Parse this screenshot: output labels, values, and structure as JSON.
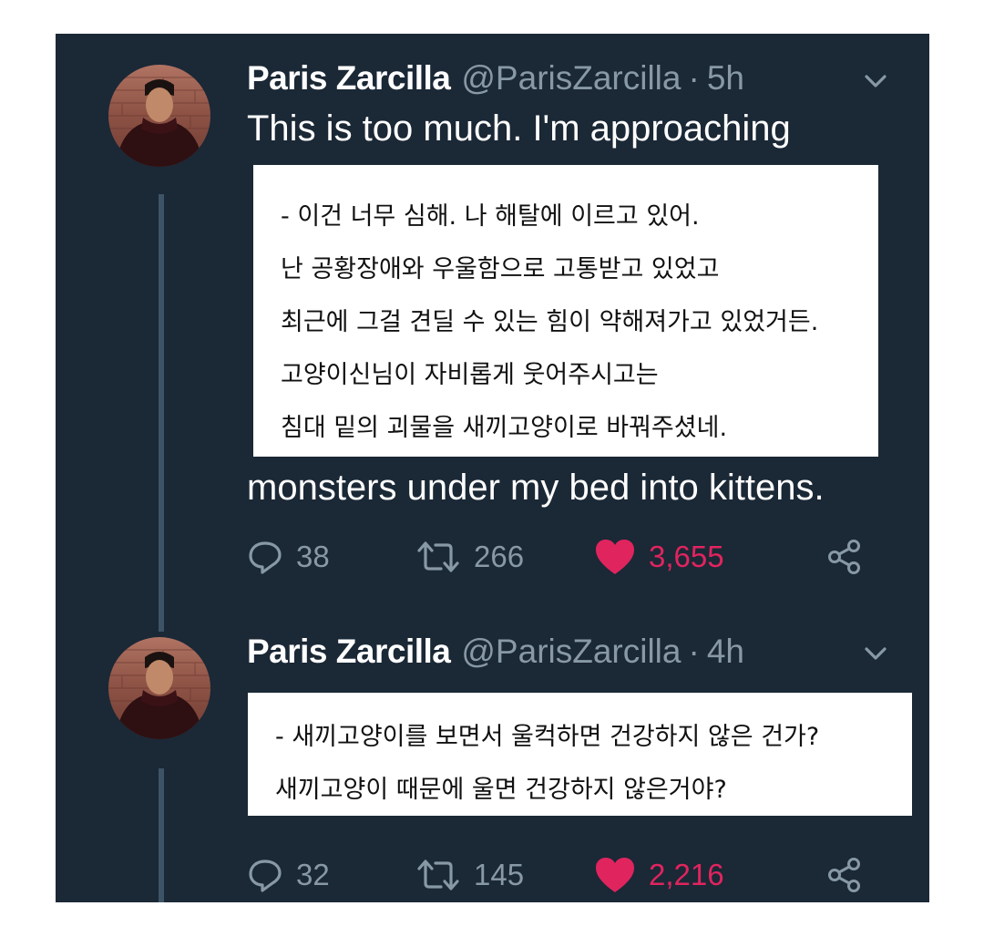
{
  "tweets": [
    {
      "name": "Paris Zarcilla",
      "handle": "@ParisZarcilla",
      "dot": "·",
      "time": "5h",
      "text_first_line": "This is too much. I'm approaching",
      "text_last_line": "monsters under my bed into kittens.",
      "replies": "38",
      "retweets": "266",
      "likes": "3,655",
      "overlay_lines": [
        "- 이건 너무 심해. 나 해탈에 이르고 있어.",
        "난 공황장애와 우울함으로 고통받고 있었고",
        "최근에 그걸 견딜 수 있는 힘이 약해져가고 있었거든.",
        "고양이신님이 자비롭게 웃어주시고는",
        "침대 밑의 괴물을 새끼고양이로 바꿔주셨네."
      ]
    },
    {
      "name": "Paris Zarcilla",
      "handle": "@ParisZarcilla",
      "dot": "·",
      "time": "4h",
      "replies": "32",
      "retweets": "145",
      "likes": "2,216",
      "overlay_lines": [
        "- 새끼고양이를 보면서 울컥하면 건강하지 않은 건가?",
        "새끼고양이 때문에 울면 건강하지 않은거야?"
      ]
    }
  ],
  "icons": {
    "reply": "reply-icon",
    "retweet": "retweet-icon",
    "like": "heart-icon",
    "share": "share-icon",
    "more": "chevron-down-icon"
  },
  "colors": {
    "background": "#1b2836",
    "secondary_text": "#8899a6",
    "like": "#e0245e",
    "thread_line": "#3d5466"
  }
}
